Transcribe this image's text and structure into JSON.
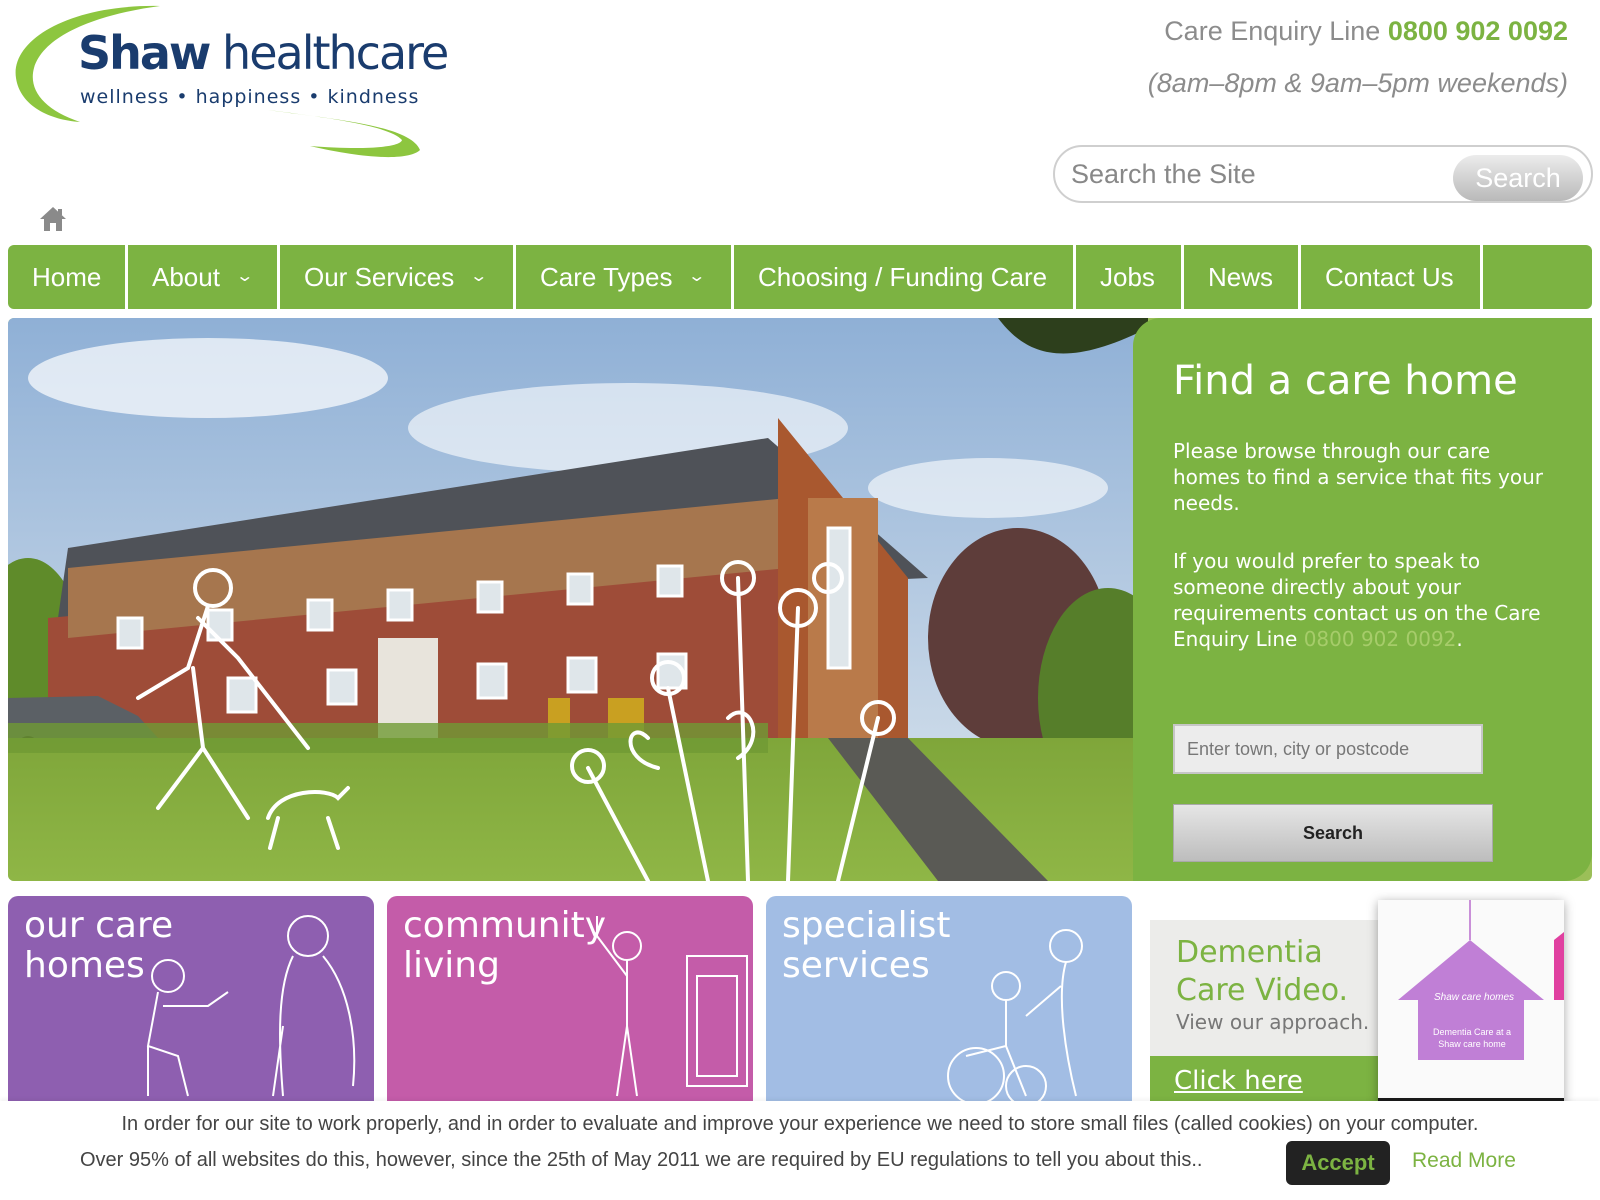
{
  "brand": {
    "name_bold": "Shaw",
    "name_rest": " healthcare",
    "tagline": "wellness • happiness • kindness",
    "accent": "#7cb342",
    "navy": "#1a3c6e"
  },
  "header": {
    "enquiry_label": "Care Enquiry Line ",
    "enquiry_phone": "0800 902 0092",
    "hours": "(8am–8pm & 9am–5pm weekends)",
    "search_placeholder": "Search the Site",
    "search_button": "Search",
    "home_icon": "home-icon"
  },
  "nav": {
    "items": [
      {
        "label": "Home",
        "dropdown": false
      },
      {
        "label": "About",
        "dropdown": true
      },
      {
        "label": "Our Services",
        "dropdown": true
      },
      {
        "label": "Care Types",
        "dropdown": true
      },
      {
        "label": "Choosing / Funding Care",
        "dropdown": false
      },
      {
        "label": "Jobs",
        "dropdown": false
      },
      {
        "label": "News",
        "dropdown": false
      },
      {
        "label": "Contact Us",
        "dropdown": false
      }
    ],
    "dropdown_glyph": "⌄"
  },
  "finder": {
    "title": "Find a care home",
    "p1": "Please browse through our care homes to find a service that fits your needs.",
    "p2_text": "If you would prefer to speak to someone directly about your requirements contact us on the Care Enquiry Line ",
    "p2_phone": "0800 902 0092",
    "p2_end": ".",
    "input_placeholder": "Enter town, city or postcode",
    "button": "Search"
  },
  "tiles": [
    {
      "label": "our care\nhomes",
      "color": "#8e5fb0"
    },
    {
      "label": "community\nliving",
      "color": "#c45ca9"
    },
    {
      "label": "specialist\nservices",
      "color": "#a2bde4"
    }
  ],
  "dementia": {
    "title": "Dementia\nCare Video.",
    "subtitle": "View our approach.",
    "cta": "Click here",
    "video_brand": "Shaw care homes",
    "video_caption": "Dementia Care at a Shaw care home"
  },
  "cookie": {
    "line1": "In order for our site to work properly, and in order to evaluate and improve your experience we need to store small files (called cookies) on your computer.",
    "line2": "Over 95% of all websites do this, however, since the 25th of May 2011 we are required by EU regulations to tell you about this..",
    "accept": "Accept",
    "read_more": "Read More"
  }
}
